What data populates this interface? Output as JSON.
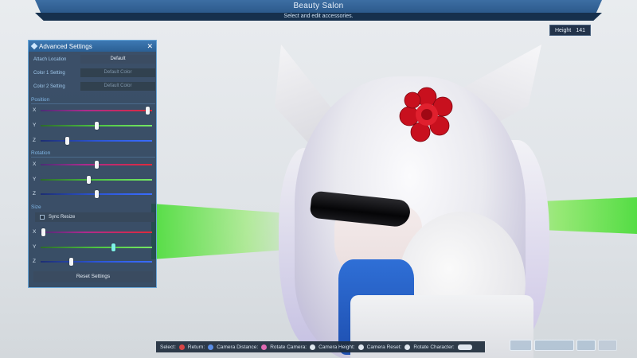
{
  "header": {
    "title": "Beauty Salon",
    "subtitle": "Select and edit accessories."
  },
  "height_readout": {
    "label": "Height",
    "value": "141"
  },
  "panel": {
    "title": "Advanced Settings",
    "close_glyph": "✕",
    "settings": [
      {
        "label": "Attach Location",
        "value": "Default"
      },
      {
        "label": "Color 1 Setting",
        "value": "Default Color"
      },
      {
        "label": "Color 2 Setting",
        "value": "Default Color"
      }
    ],
    "position": {
      "label": "Position",
      "x": {
        "axis": "X",
        "value": 0.98
      },
      "y": {
        "axis": "Y",
        "value": 0.5
      },
      "z": {
        "axis": "Z",
        "value": 0.23
      }
    },
    "rotation": {
      "label": "Rotation",
      "x": {
        "axis": "X",
        "value": 0.5
      },
      "y": {
        "axis": "Y",
        "value": 0.43
      },
      "z": {
        "axis": "Z",
        "value": 0.5
      }
    },
    "size": {
      "label": "Size",
      "sync_resize": "Sync Resize",
      "x": {
        "axis": "X",
        "value": 0.01
      },
      "y": {
        "axis": "Y",
        "value": 0.66
      },
      "z": {
        "axis": "Z",
        "value": 0.27
      }
    },
    "reset_label": "Reset Settings"
  },
  "controls": {
    "select": "Select:",
    "return": "Return:",
    "camera_distance": "Camera Distance:",
    "rotate_camera": "Rotate Camera:",
    "camera_height": "Camera Height:",
    "camera_reset": "Camera Reset:",
    "rotate_character": "Rotate Character:"
  },
  "colors": {
    "panel_bg": "#1e3652",
    "panel_border": "#6aa7d8",
    "header_blue": "#2c5a8c",
    "flower_red": "#c8101e"
  }
}
